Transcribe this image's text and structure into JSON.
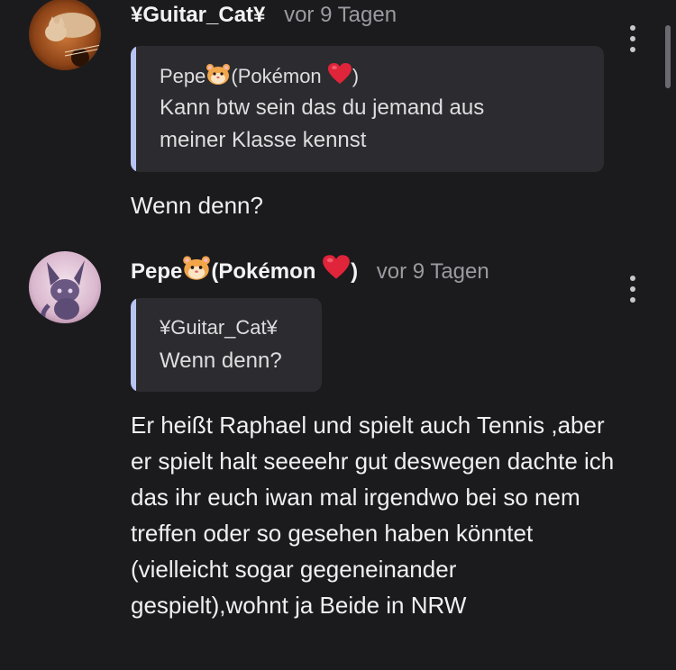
{
  "comments": [
    {
      "author": "¥Guitar_Cat¥",
      "time": "vor 9 Tagen",
      "avatar": "cat-on-guitar",
      "quote": {
        "author_name": "Pepe",
        "author_suffix": "(Pokémon",
        "author_close": ")",
        "text": "Kann btw sein das du jemand aus meiner Klasse kennst"
      },
      "text": "Wenn denn?"
    },
    {
      "author_name": "Pepe",
      "author_suffix": "(Pokémon",
      "author_close": ")",
      "time": "vor 9 Tagen",
      "avatar": "dark-eevee-creature",
      "quote": {
        "author": "¥Guitar_Cat¥",
        "text": "Wenn denn?"
      },
      "text": "Er heißt Raphael und spielt auch Tennis ,aber er spielt halt seeeehr gut deswegen dachte ich das ihr euch iwan mal irgendwo bei so nem treffen oder so gesehen haben könntet (vielleicht sogar gegeneinander gespielt),wohnt ja Beide in NRW"
    }
  ],
  "icons": {
    "hamster": "hamster-emoji",
    "heart": "red-heart-emoji",
    "more": "more-vertical-icon"
  },
  "colors": {
    "background": "#1b1b1e",
    "quote_background": "#2c2c30",
    "quote_accent": "#b8c4f2",
    "muted_text": "#9a9aa0",
    "heart": "#e0243a"
  }
}
